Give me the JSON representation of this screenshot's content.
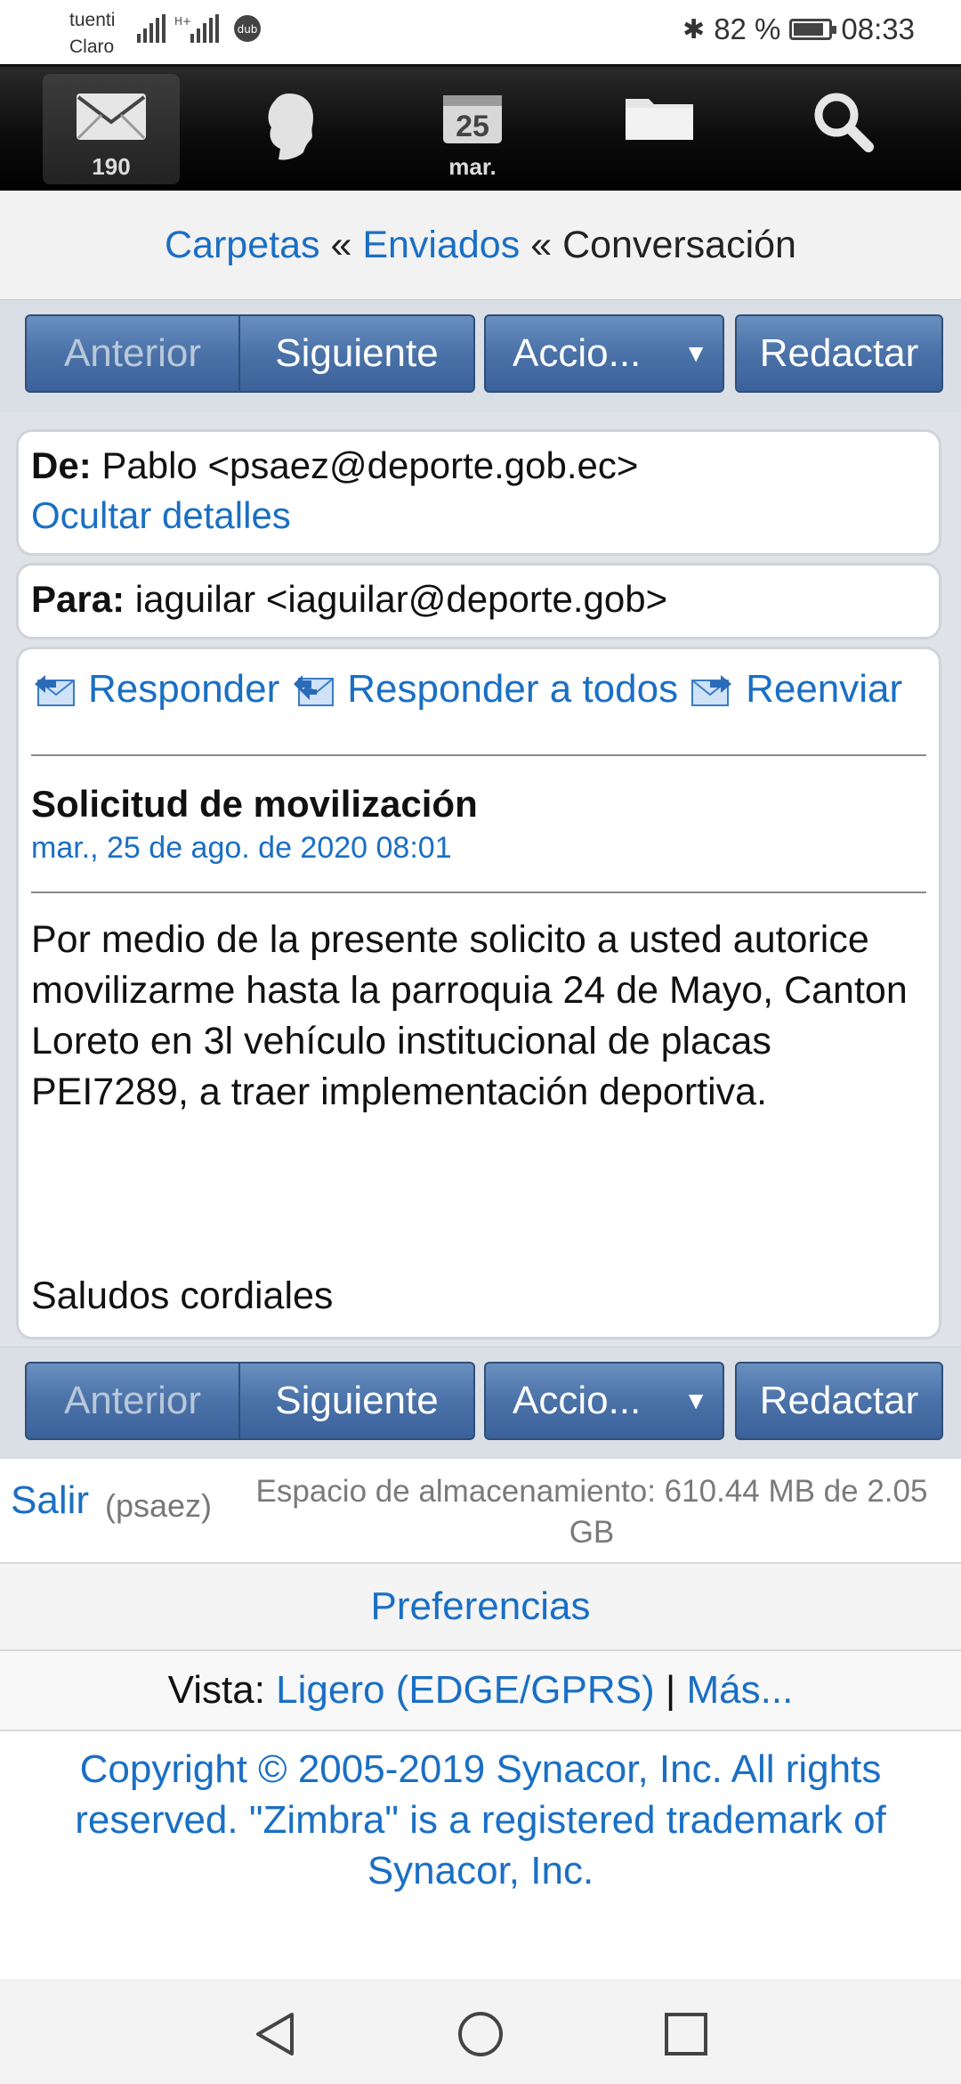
{
  "status_bar": {
    "carrier_top": "tuenti",
    "carrier_bottom": "Claro",
    "battery_percent": "82 %",
    "time": "08:33",
    "battery_level": 0.82
  },
  "nav": {
    "mail_count": "190",
    "calendar_day": "25",
    "calendar_label": "mar."
  },
  "breadcrumb": {
    "folders": "Carpetas",
    "sep1": "«",
    "sent": "Enviados",
    "sep2": "«",
    "current": "Conversación"
  },
  "toolbar": {
    "prev": "Anterior",
    "next": "Siguiente",
    "actions": "Accio...",
    "compose": "Redactar"
  },
  "message": {
    "from_label": "De:",
    "from_value": "Pablo <psaez@deporte.gob.ec>",
    "hide_details": "Ocultar detalles",
    "to_label": "Para:",
    "to_value": "iaguilar <iaguilar@deporte.gob>",
    "reply": "Responder",
    "reply_all": "Responder a todos",
    "forward": "Reenviar",
    "subject": "Solicitud de movilización",
    "date": "mar., 25 de ago. de 2020 08:01",
    "body": "Por medio de la presente solicito a usted autorice movilizarme hasta la parroquia 24 de Mayo, Canton Loreto en 3l vehículo institucional de placas PEI7289, a traer implementación deportiva.",
    "signoff": "Saludos cordiales"
  },
  "footer": {
    "logout": "Salir",
    "username": "(psaez)",
    "storage": "Espacio de almacenamiento: 610.44 MB de 2.05 GB",
    "preferences": "Preferencias",
    "view_label": "Vista:",
    "view_value": "Ligero (EDGE/GPRS)",
    "view_sep": "|",
    "more": "Más...",
    "copyright": "Copyright © 2005-2019 Synacor, Inc. All rights reserved. \"Zimbra\" is a registered trademark of Synacor, Inc."
  },
  "colors": {
    "link": "#1a6fc4",
    "button": "#4a72a8",
    "appbar": "#000000"
  }
}
